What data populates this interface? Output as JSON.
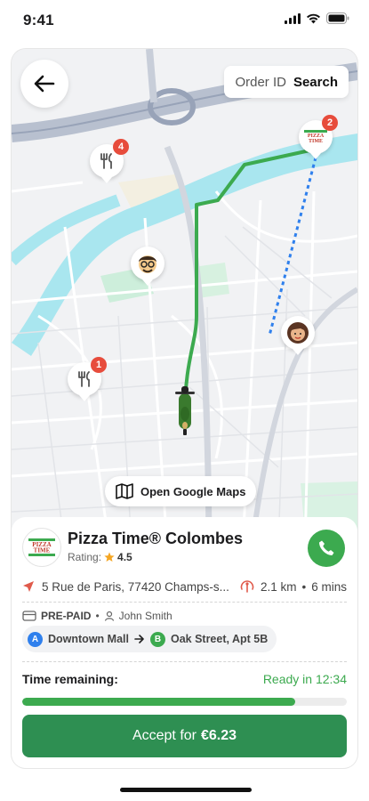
{
  "status_bar": {
    "time": "9:41"
  },
  "map": {
    "toggle": {
      "order_id": "Order ID",
      "search": "Search"
    },
    "pins": [
      {
        "type": "restaurant",
        "badge": "4"
      },
      {
        "type": "pizza-time",
        "badge": "2"
      },
      {
        "type": "restaurant",
        "badge": "1"
      },
      {
        "type": "customer-man"
      },
      {
        "type": "customer-woman"
      }
    ],
    "open_google_maps": "Open Google Maps",
    "route_color": "#3caa4f",
    "dotted_route_color": "#2f80ed"
  },
  "order": {
    "restaurant_name": "Pizza Time® Colombes",
    "rating_label": "Rating:",
    "rating_value": "4.5",
    "address": "5 Rue de Paris, 77420 Champs-s...",
    "distance": "2.1 km",
    "duration": "6 mins",
    "payment": "PRE-PAID",
    "customer": "John Smith",
    "from_letter": "A",
    "from": "Downtown Mall",
    "to_letter": "B",
    "to": "Oak Street, Apt 5B",
    "time_remaining_label": "Time remaining:",
    "ready_text": "Ready in 12:34",
    "progress": 0.84,
    "accept_prefix": "Accept for",
    "accept_amount": "€6.23",
    "colors": {
      "accent": "#3caa4f",
      "button": "#2e8f52",
      "from": "#2f80ed",
      "to": "#3caa4f"
    }
  }
}
